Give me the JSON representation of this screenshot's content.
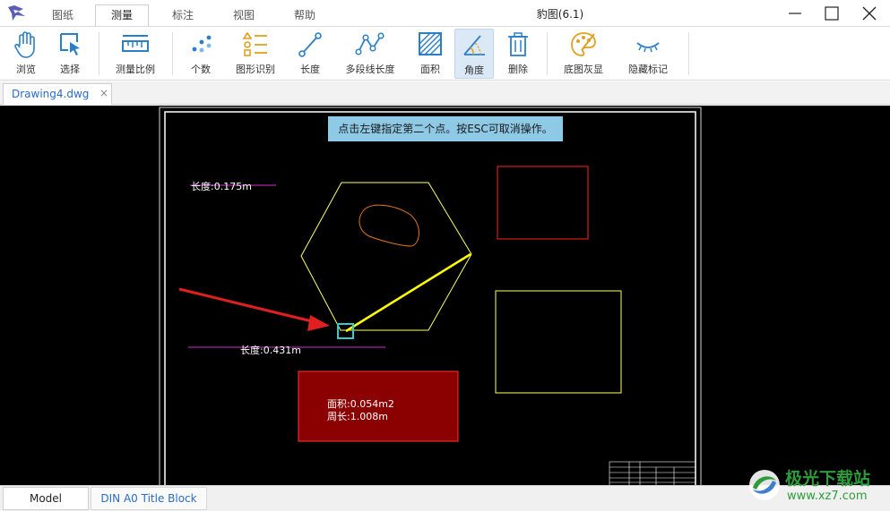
{
  "window": {
    "title": "豹图(6.1)",
    "menu_tabs": [
      {
        "label": "图纸"
      },
      {
        "label": "测量",
        "active": true
      },
      {
        "label": "标注"
      },
      {
        "label": "视图"
      },
      {
        "label": "帮助"
      }
    ],
    "controls": [
      "minimize-icon",
      "maximize-icon",
      "close-icon"
    ]
  },
  "toolbar": {
    "tools": [
      {
        "label": "浏览",
        "icon": "hand-icon"
      },
      {
        "label": "选择",
        "icon": "select-cursor-icon"
      },
      {
        "label": "测量比例",
        "icon": "ruler-icon"
      },
      {
        "label": "个数",
        "icon": "count-dots-icon"
      },
      {
        "label": "图形识别",
        "icon": "shape-recognize-icon"
      },
      {
        "label": "长度",
        "icon": "length-icon"
      },
      {
        "label": "多段线长度",
        "icon": "polyline-icon"
      },
      {
        "label": "面积",
        "icon": "area-icon"
      },
      {
        "label": "角度",
        "icon": "angle-icon",
        "active": true
      },
      {
        "label": "删除",
        "icon": "trash-icon"
      },
      {
        "label": "底图灰显",
        "icon": "palette-icon"
      },
      {
        "label": "隐藏标记",
        "icon": "eye-closed-icon"
      }
    ]
  },
  "document_tab": {
    "label": "Drawing4.dwg",
    "close": "×"
  },
  "canvas": {
    "hint": "点击左键指定第二个点。按ESC可取消操作。",
    "annotations": {
      "length1": "长度:0.175m",
      "length2": "长度:0.431m",
      "area": "面积:0.054m2",
      "perimeter": "周长:1.008m"
    },
    "colors": {
      "background": "#000000",
      "hexagon": "#ffff66",
      "measure_line": "#ffff00",
      "magenta_line": "#cc33cc",
      "red_rect": "#ff2222",
      "area_fill": "#8b0000",
      "cursor_box": "#33cccc",
      "arrow": "#e02020"
    }
  },
  "layout_tabs": [
    {
      "label": "Model",
      "active": true
    },
    {
      "label": "DIN A0 Title Block"
    }
  ],
  "watermark": {
    "title": "极光下载站",
    "url": "www.xz7.com"
  }
}
